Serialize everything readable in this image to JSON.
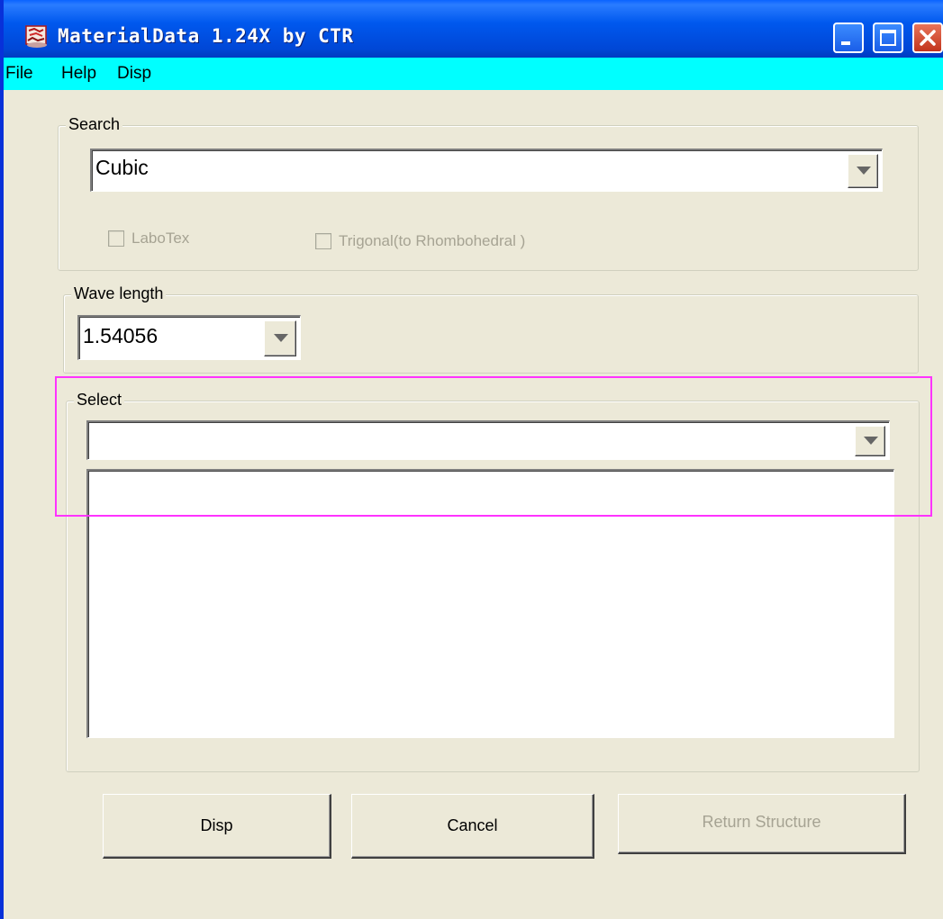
{
  "window": {
    "title": "MaterialData 1.24X by CTR",
    "icon": "app-icon",
    "controls": [
      "minimize-icon",
      "maximize-icon",
      "close-icon"
    ],
    "colors": {
      "titlebar": "#0054e3",
      "menubar": "#00ffff",
      "face": "#ece9d8",
      "highlight": "#ff33ff"
    }
  },
  "menu": {
    "items": [
      {
        "label": "File"
      },
      {
        "label": "Help"
      },
      {
        "label": "Disp"
      }
    ]
  },
  "search": {
    "legend": "Search",
    "value": "Cubic",
    "labotex_label": "LaboTex",
    "labotex_checked": false,
    "trigonal_label": "Trigonal(to Rhombohedral )",
    "trigonal_checked": false
  },
  "wave": {
    "legend": "Wave length",
    "value": "1.54056"
  },
  "select": {
    "legend": "Select",
    "value": "",
    "list_items": []
  },
  "buttons": {
    "disp": "Disp",
    "cancel": "Cancel",
    "return": "Return Structure"
  }
}
